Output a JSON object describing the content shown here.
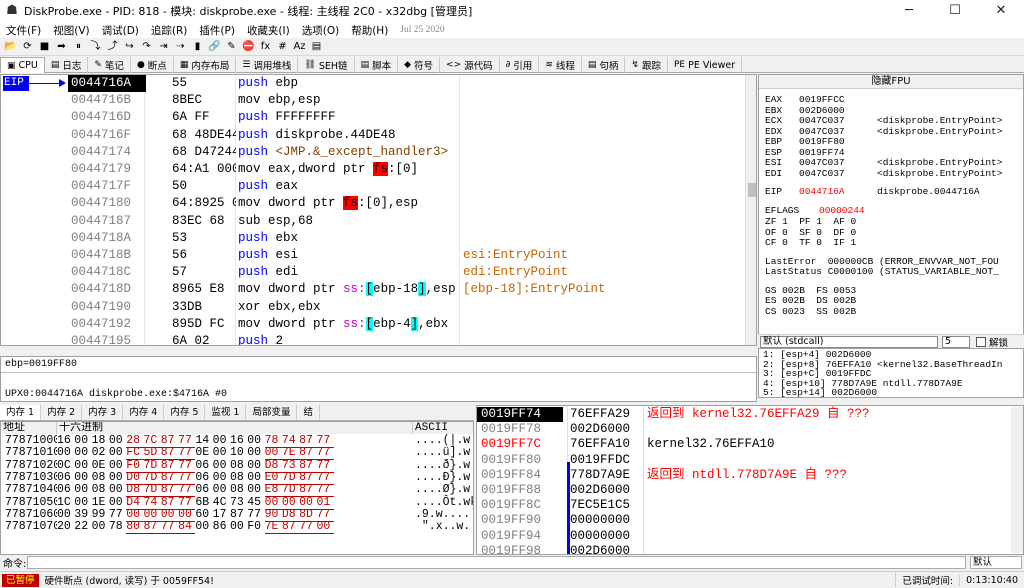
{
  "window": {
    "title": "DiskProbe.exe - PID: 818 - 模块: diskprobe.exe - 线程: 主线程 2C0 - x32dbg [管理员]",
    "minimize": "─",
    "maximize": "☐",
    "close": "✕"
  },
  "menu": {
    "items": [
      "文件(F)",
      "视图(V)",
      "调试(D)",
      "追踪(R)",
      "插件(P)",
      "收藏夹(I)",
      "选项(O)",
      "帮助(H)"
    ],
    "date": "Jul 25 2020"
  },
  "toolbar": {
    "icons": [
      "📂",
      "⟳",
      "■",
      "➡",
      "⏸",
      "⤵",
      "⤴",
      "↪",
      "↷",
      "⇥",
      "⇢",
      "▮",
      "🔗",
      "✎",
      "⛔",
      "fx",
      "#",
      "Az",
      "▤"
    ]
  },
  "tabs": [
    {
      "icon": "▣",
      "label": "CPU"
    },
    {
      "icon": "▤",
      "label": "日志"
    },
    {
      "icon": "✎",
      "label": "笔记"
    },
    {
      "icon": "●",
      "label": "断点"
    },
    {
      "icon": "▦",
      "label": "内存布局"
    },
    {
      "icon": "☰",
      "label": "调用堆栈"
    },
    {
      "icon": "⛓",
      "label": "SEH链"
    },
    {
      "icon": "▤",
      "label": "脚本"
    },
    {
      "icon": "◆",
      "label": "符号"
    },
    {
      "icon": "<>",
      "label": "源代码"
    },
    {
      "icon": "∂",
      "label": "引用"
    },
    {
      "icon": "≋",
      "label": "线程"
    },
    {
      "icon": "▤",
      "label": "句柄"
    },
    {
      "icon": "↯",
      "label": "跟踪"
    },
    {
      "icon": "PE",
      "label": "PE Viewer"
    }
  ],
  "disasm": {
    "eip_label": "EIP",
    "rows": [
      {
        "addr": "0044716A",
        "bytes": "55",
        "ins": [
          [
            "push",
            "kw-push"
          ],
          [
            " ebp",
            ""
          ]
        ],
        "cmt": "",
        "sel": true
      },
      {
        "addr": "0044716B",
        "bytes": "8BEC",
        "ins": [
          [
            "mov ebp,esp",
            ""
          ]
        ],
        "cmt": ""
      },
      {
        "addr": "0044716D",
        "bytes": "6A FF",
        "ins": [
          [
            "push",
            "kw-push"
          ],
          [
            " FFFFFFFF",
            ""
          ]
        ],
        "cmt": ""
      },
      {
        "addr": "0044716F",
        "bytes": "68 48DE44",
        "ins": [
          [
            "push",
            "kw-push"
          ],
          [
            " diskprobe.44DE48",
            ""
          ]
        ],
        "cmt": ""
      },
      {
        "addr": "00447174",
        "bytes": "68 D47244",
        "ins": [
          [
            "push",
            "kw-push"
          ],
          [
            " <JMP.&_except_handler3>",
            "strg"
          ]
        ],
        "cmt": ""
      },
      {
        "addr": "00447179",
        "bytes": "64:A1 000",
        "ins": [
          [
            "mov eax,dword ptr ",
            ""
          ],
          [
            "fs",
            "fsreg"
          ],
          [
            ":[0]",
            ""
          ]
        ],
        "cmt": ""
      },
      {
        "addr": "0044717F",
        "bytes": "50",
        "ins": [
          [
            "push",
            "kw-push"
          ],
          [
            " eax",
            ""
          ]
        ],
        "cmt": ""
      },
      {
        "addr": "00447180",
        "bytes": "64:8925 0",
        "ins": [
          [
            "mov dword ptr ",
            ""
          ],
          [
            "fs",
            "fsreg"
          ],
          [
            ":[0],esp",
            ""
          ]
        ],
        "cmt": ""
      },
      {
        "addr": "00447187",
        "bytes": "83EC 68",
        "ins": [
          [
            "sub esp,68",
            ""
          ]
        ],
        "cmt": ""
      },
      {
        "addr": "0044718A",
        "bytes": "53",
        "ins": [
          [
            "push",
            "kw-push"
          ],
          [
            " ebx",
            ""
          ]
        ],
        "cmt": ""
      },
      {
        "addr": "0044718B",
        "bytes": "56",
        "ins": [
          [
            "push",
            "kw-push"
          ],
          [
            " esi",
            ""
          ]
        ],
        "cmt": "esi:EntryPoint"
      },
      {
        "addr": "0044718C",
        "bytes": "57",
        "ins": [
          [
            "push",
            "kw-push"
          ],
          [
            " edi",
            ""
          ]
        ],
        "cmt": "edi:EntryPoint"
      },
      {
        "addr": "0044718D",
        "bytes": "8965 E8",
        "ins": [
          [
            "mov dword ptr ",
            ""
          ],
          [
            "ss:",
            "seg"
          ],
          [
            "[",
            "brk"
          ],
          [
            "ebp-18",
            ""
          ],
          [
            "]",
            "brk"
          ],
          [
            ",esp",
            ""
          ]
        ],
        "cmt": "[ebp-18]:EntryPoint"
      },
      {
        "addr": "00447190",
        "bytes": "33DB",
        "ins": [
          [
            "xor ebx,ebx",
            ""
          ]
        ],
        "cmt": ""
      },
      {
        "addr": "00447192",
        "bytes": "895D FC",
        "ins": [
          [
            "mov dword ptr ",
            ""
          ],
          [
            "ss:",
            "seg"
          ],
          [
            "[",
            "brk"
          ],
          [
            "ebp-4",
            ""
          ],
          [
            "]",
            "brk"
          ],
          [
            ",ebx",
            ""
          ]
        ],
        "cmt": ""
      },
      {
        "addr": "00447195",
        "bytes": "6A 02",
        "ins": [
          [
            "push",
            "kw-push"
          ],
          [
            " 2",
            ""
          ]
        ],
        "cmt": ""
      }
    ]
  },
  "registers": {
    "header": "隐藏FPU",
    "lines": [
      {
        "n": "EAX",
        "v": "0019FFCC",
        "c": ""
      },
      {
        "n": "EBX",
        "v": "002D6000",
        "c": ""
      },
      {
        "n": "ECX",
        "v": "0047C037",
        "c": "<diskprobe.EntryPoint>"
      },
      {
        "n": "EDX",
        "v": "0047C037",
        "c": "<diskprobe.EntryPoint>"
      },
      {
        "n": "EBP",
        "v": "0019FF80",
        "c": ""
      },
      {
        "n": "ESP",
        "v": "0019FF74",
        "c": ""
      },
      {
        "n": "ESI",
        "v": "0047C037",
        "c": "<diskprobe.EntryPoint>"
      },
      {
        "n": "EDI",
        "v": "0047C037",
        "c": "<diskprobe.EntryPoint>"
      }
    ],
    "eip": {
      "n": "EIP",
      "v": "0044716A",
      "c": "diskprobe.0044716A"
    },
    "eflags_label": "EFLAGS",
    "eflags": "00000244",
    "flags": [
      "ZF 1  PF 1  AF 0",
      "OF 0  SF 0  DF 0",
      "CF 0  TF 0  IF 1"
    ],
    "last_error": "LastError  000000CB (ERROR_ENVVAR_NOT_FOU",
    "last_status": "LastStatus C0000100 (STATUS_VARIABLE_NOT_",
    "segs": [
      "GS 002B  FS 0053",
      "ES 002B  DS 002B",
      "CS 0023  SS 002B"
    ]
  },
  "args": {
    "callconv": "默认 (stdcall)",
    "count": "5",
    "unlock": "解锁",
    "rows": [
      "1: [esp+4] 002D6000",
      "2: [esp+8] 76EFFA10 <kernel32.BaseThreadIn",
      "3: [esp+C] 0019FFDC",
      "4: [esp+10] 778D7A9E ntdll.778D7A9E",
      "5: [esp+14] 002D6000"
    ]
  },
  "info": {
    "line1": "ebp=0019FF80",
    "line2": "UPX0:0044716A diskprobe.exe:$4716A #0"
  },
  "dumptabs": [
    "内存 1",
    "内存 2",
    "内存 3",
    "内存 4",
    "内存 5",
    "监视 1",
    "局部变量",
    "结"
  ],
  "dump": {
    "hdr_addr": "地址",
    "hdr_hex": "十六进制",
    "hdr_ascii": "ASCII",
    "rows": [
      {
        "a": "77871000",
        "h": [
          "16",
          "00",
          "18",
          "00",
          "28",
          "7C",
          "87",
          "77",
          "14",
          "00",
          "16",
          "00",
          "78",
          "74",
          "87",
          "77"
        ],
        "s": "....(|.w....xt.w"
      },
      {
        "a": "77871010",
        "h": [
          "00",
          "00",
          "02",
          "00",
          "FC",
          "5D",
          "87",
          "77",
          "0E",
          "00",
          "10",
          "00",
          "00",
          "7E",
          "87",
          "77"
        ],
        "s": "....ü].w.....~.w"
      },
      {
        "a": "77871020",
        "h": [
          "0C",
          "00",
          "0E",
          "00",
          "F0",
          "7D",
          "87",
          "77",
          "06",
          "00",
          "08",
          "00",
          "D8",
          "73",
          "87",
          "77"
        ],
        "s": "....ð}.w....Øs.w"
      },
      {
        "a": "77871030",
        "h": [
          "06",
          "00",
          "08",
          "00",
          "D0",
          "7D",
          "87",
          "77",
          "06",
          "00",
          "08",
          "00",
          "E0",
          "7D",
          "87",
          "77"
        ],
        "s": "....Ð}.w....à}.w"
      },
      {
        "a": "77871040",
        "h": [
          "06",
          "00",
          "08",
          "00",
          "D8",
          "7D",
          "87",
          "77",
          "06",
          "00",
          "08",
          "00",
          "E8",
          "7D",
          "87",
          "77"
        ],
        "s": "....Ø}.w....è}.w"
      },
      {
        "a": "77871050",
        "h": [
          "1C",
          "00",
          "1E",
          "00",
          "D4",
          "74",
          "87",
          "77",
          "6B",
          "4C",
          "73",
          "45",
          "00",
          "00",
          "00",
          "01"
        ],
        "s": "....Ôt.wkLsE...."
      },
      {
        "a": "77871060",
        "h": [
          "00",
          "39",
          "99",
          "77",
          "00",
          "00",
          "00",
          "00",
          "60",
          "17",
          "87",
          "77",
          "90",
          "D8",
          "8D",
          "77"
        ],
        "s": ".9.w....`..w.Ø.w"
      },
      {
        "a": "77871070",
        "h": [
          "20",
          "22",
          "00",
          "78",
          "80",
          "87",
          "77",
          "84",
          "00",
          "86",
          "00",
          "F0",
          "7E",
          "87",
          "77",
          "00"
        ],
        "s": " \".x..w....ð~.w."
      }
    ]
  },
  "stack": {
    "rows": [
      {
        "a": "0019FF74",
        "v": "76EFFA29",
        "c": "返回到 kernel32.76EFFA29 自 ???",
        "red": true,
        "sel": true
      },
      {
        "a": "0019FF78",
        "v": "002D6000",
        "c": "",
        "red": false
      },
      {
        "a": "0019FF7C",
        "v": "76EFFA10",
        "c": "kernel32.76EFFA10",
        "red": false,
        "ebp": true
      },
      {
        "a": "0019FF80",
        "v": "0019FFDC",
        "c": "",
        "red": false
      },
      {
        "a": "0019FF84",
        "v": "778D7A9E",
        "c": "返回到 ntdll.778D7A9E 自 ???",
        "red": true
      },
      {
        "a": "0019FF88",
        "v": "002D6000",
        "c": "",
        "red": false
      },
      {
        "a": "0019FF8C",
        "v": "7EC5E1C5",
        "c": "",
        "red": false
      },
      {
        "a": "0019FF90",
        "v": "00000000",
        "c": "",
        "red": false
      },
      {
        "a": "0019FF94",
        "v": "00000000",
        "c": "",
        "red": false
      },
      {
        "a": "0019FF98",
        "v": "002D6000",
        "c": "",
        "red": false
      }
    ]
  },
  "command": {
    "label": "命令:",
    "default": "默认"
  },
  "status": {
    "paused": "已暂停",
    "message": "硬件断点 (dword, 读写) 于 0059FF54!",
    "time_label": "已调试时间:",
    "time": "0:13:10:40"
  }
}
